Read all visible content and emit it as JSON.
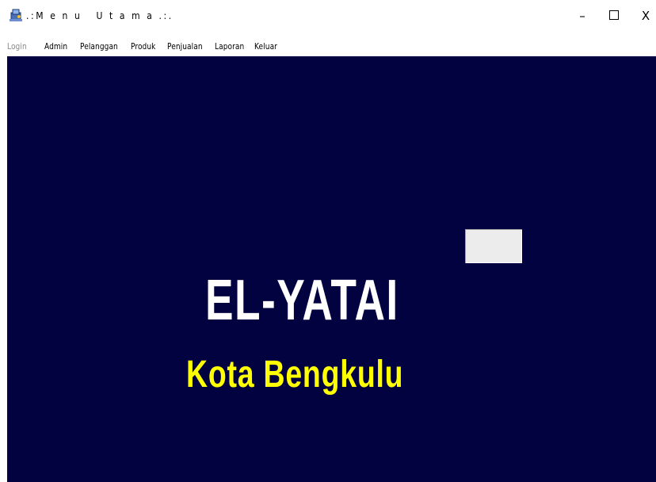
{
  "window": {
    "title": ".:M e n u   U t a m a .:.",
    "controls": {
      "minimize": "–",
      "maximize_icon": "maximize-icon",
      "close": "X"
    }
  },
  "menubar": {
    "items": [
      {
        "label": "Login",
        "enabled": false
      },
      {
        "label": "Admin",
        "enabled": true
      },
      {
        "label": "Pelanggan",
        "enabled": true
      },
      {
        "label": "Produk",
        "enabled": true
      },
      {
        "label": "Penjualan",
        "enabled": true
      },
      {
        "label": "Laporan",
        "enabled": true
      },
      {
        "label": "Keluar",
        "enabled": true
      }
    ]
  },
  "main": {
    "background_color": "#020241",
    "headline": "EL-YATAI",
    "subheadline": "Kota Bengkulu",
    "headline_color": "#ffffff",
    "subheadline_color": "#ffff00"
  }
}
